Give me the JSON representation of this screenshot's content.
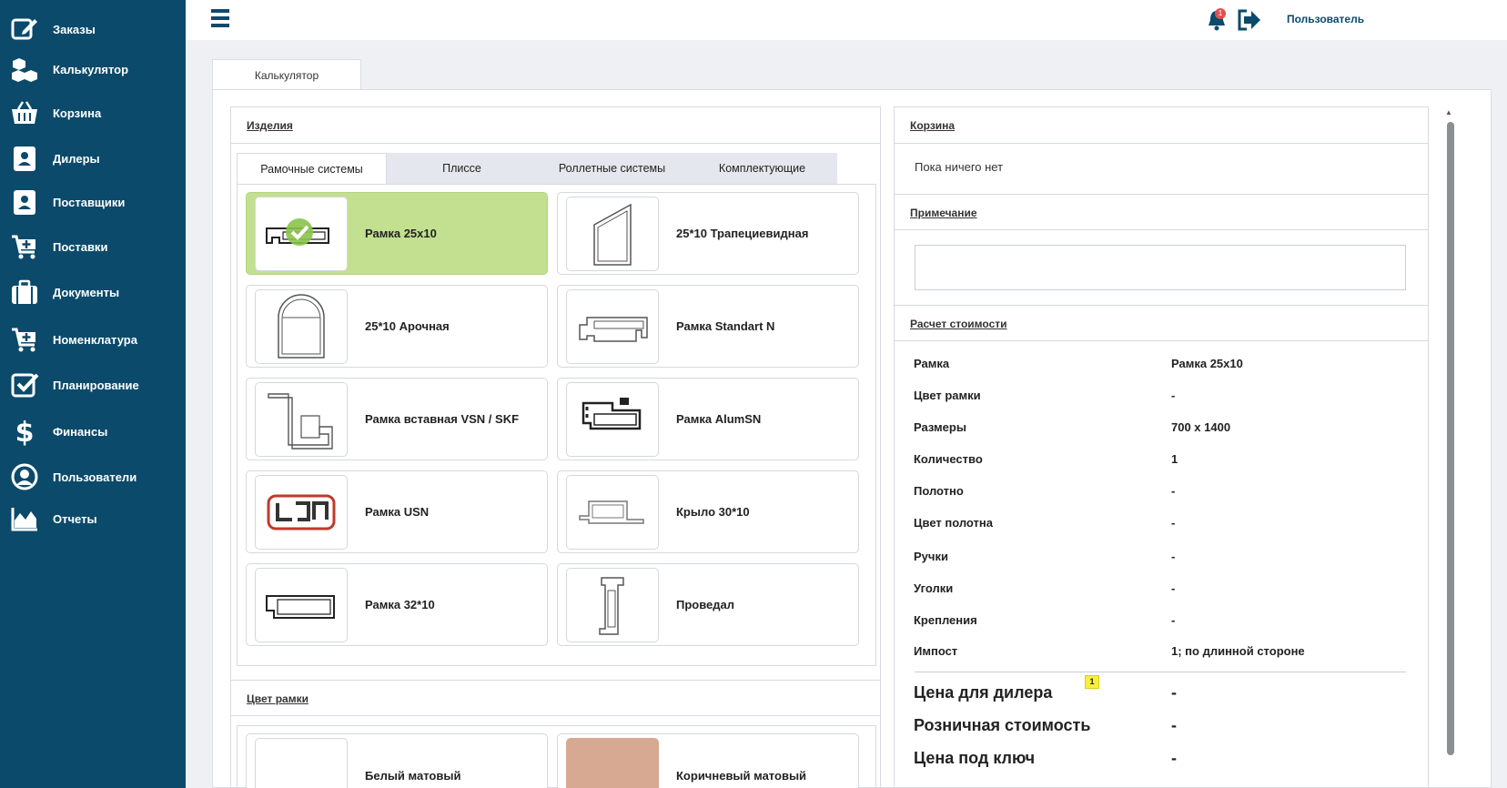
{
  "sidebar": {
    "items": [
      {
        "label": "Заказы",
        "icon": "edit-icon"
      },
      {
        "label": "Калькулятор",
        "icon": "boxes-icon"
      },
      {
        "label": "Корзина",
        "icon": "basket-icon"
      },
      {
        "label": "Дилеры",
        "icon": "contact-card-icon"
      },
      {
        "label": "Поставщики",
        "icon": "contact-card-icon"
      },
      {
        "label": "Поставки",
        "icon": "cart-plus-icon"
      },
      {
        "label": "Документы",
        "icon": "briefcase-icon"
      },
      {
        "label": "Номенклатура",
        "icon": "cart-plus-icon"
      },
      {
        "label": "Планирование",
        "icon": "checkbox-icon"
      },
      {
        "label": "Финансы",
        "icon": "dollar-icon"
      },
      {
        "label": "Пользователи",
        "icon": "user-circle-icon"
      },
      {
        "label": "Отчеты",
        "icon": "area-chart-icon"
      }
    ]
  },
  "topbar": {
    "user_label": "Пользователь",
    "notifications_count": "1"
  },
  "main_tab": "Калькулятор",
  "products": {
    "title": "Изделия",
    "tabs": [
      "Рамочные системы",
      "Плиссе",
      "Роллетные системы",
      "Комплектующие"
    ],
    "active_tab": 0,
    "items": [
      {
        "label": "Рамка 25x10",
        "selected": true
      },
      {
        "label": "25*10 Трапециевидная",
        "selected": false
      },
      {
        "label": "25*10 Арочная",
        "selected": false
      },
      {
        "label": "Рамка Standart N",
        "selected": false
      },
      {
        "label": "Рамка вставная VSN / SKF",
        "selected": false
      },
      {
        "label": "Рамка AlumSN",
        "selected": false
      },
      {
        "label": "Рамка USN",
        "selected": false
      },
      {
        "label": "Крыло 30*10",
        "selected": false
      },
      {
        "label": "Рамка 32*10",
        "selected": false
      },
      {
        "label": "Проведал",
        "selected": false
      }
    ]
  },
  "frame_color": {
    "title": "Цвет рамки",
    "items": [
      {
        "label": "Белый матовый",
        "swatch": "#ffffff"
      },
      {
        "label": "Коричневый матовый",
        "swatch": "#d7a892"
      }
    ]
  },
  "cart": {
    "title": "Корзина",
    "empty_text": "Пока ничего нет"
  },
  "note": {
    "title": "Примечание",
    "value": ""
  },
  "calc": {
    "title": "Расчет стоимости",
    "rows": [
      {
        "label": "Рамка",
        "value": "Рамка 25x10"
      },
      {
        "label": "Цвет рамки",
        "value": "-"
      },
      {
        "label": "Размеры",
        "value": "700 x 1400"
      },
      {
        "label": "Количество",
        "value": "1"
      },
      {
        "label": "Полотно",
        "value": "-"
      },
      {
        "label": "Цвет полотна",
        "value": "-"
      },
      {
        "label": "Ручки",
        "value": "-"
      },
      {
        "label": "Уголки",
        "value": "-"
      },
      {
        "label": "Крепления",
        "value": "-"
      },
      {
        "label": "Импост",
        "value": "1; по длинной стороне"
      }
    ],
    "totals": [
      {
        "label": "Цена для дилера",
        "value": "-",
        "badge": "1"
      },
      {
        "label": "Розничная стоимость",
        "value": "-"
      },
      {
        "label": "Цена под ключ",
        "value": "-"
      }
    ]
  },
  "colors": {
    "sidebar_bg": "#0b4a6b",
    "selected_tile": "#c2e08f",
    "accent": "#0b4a6b"
  }
}
